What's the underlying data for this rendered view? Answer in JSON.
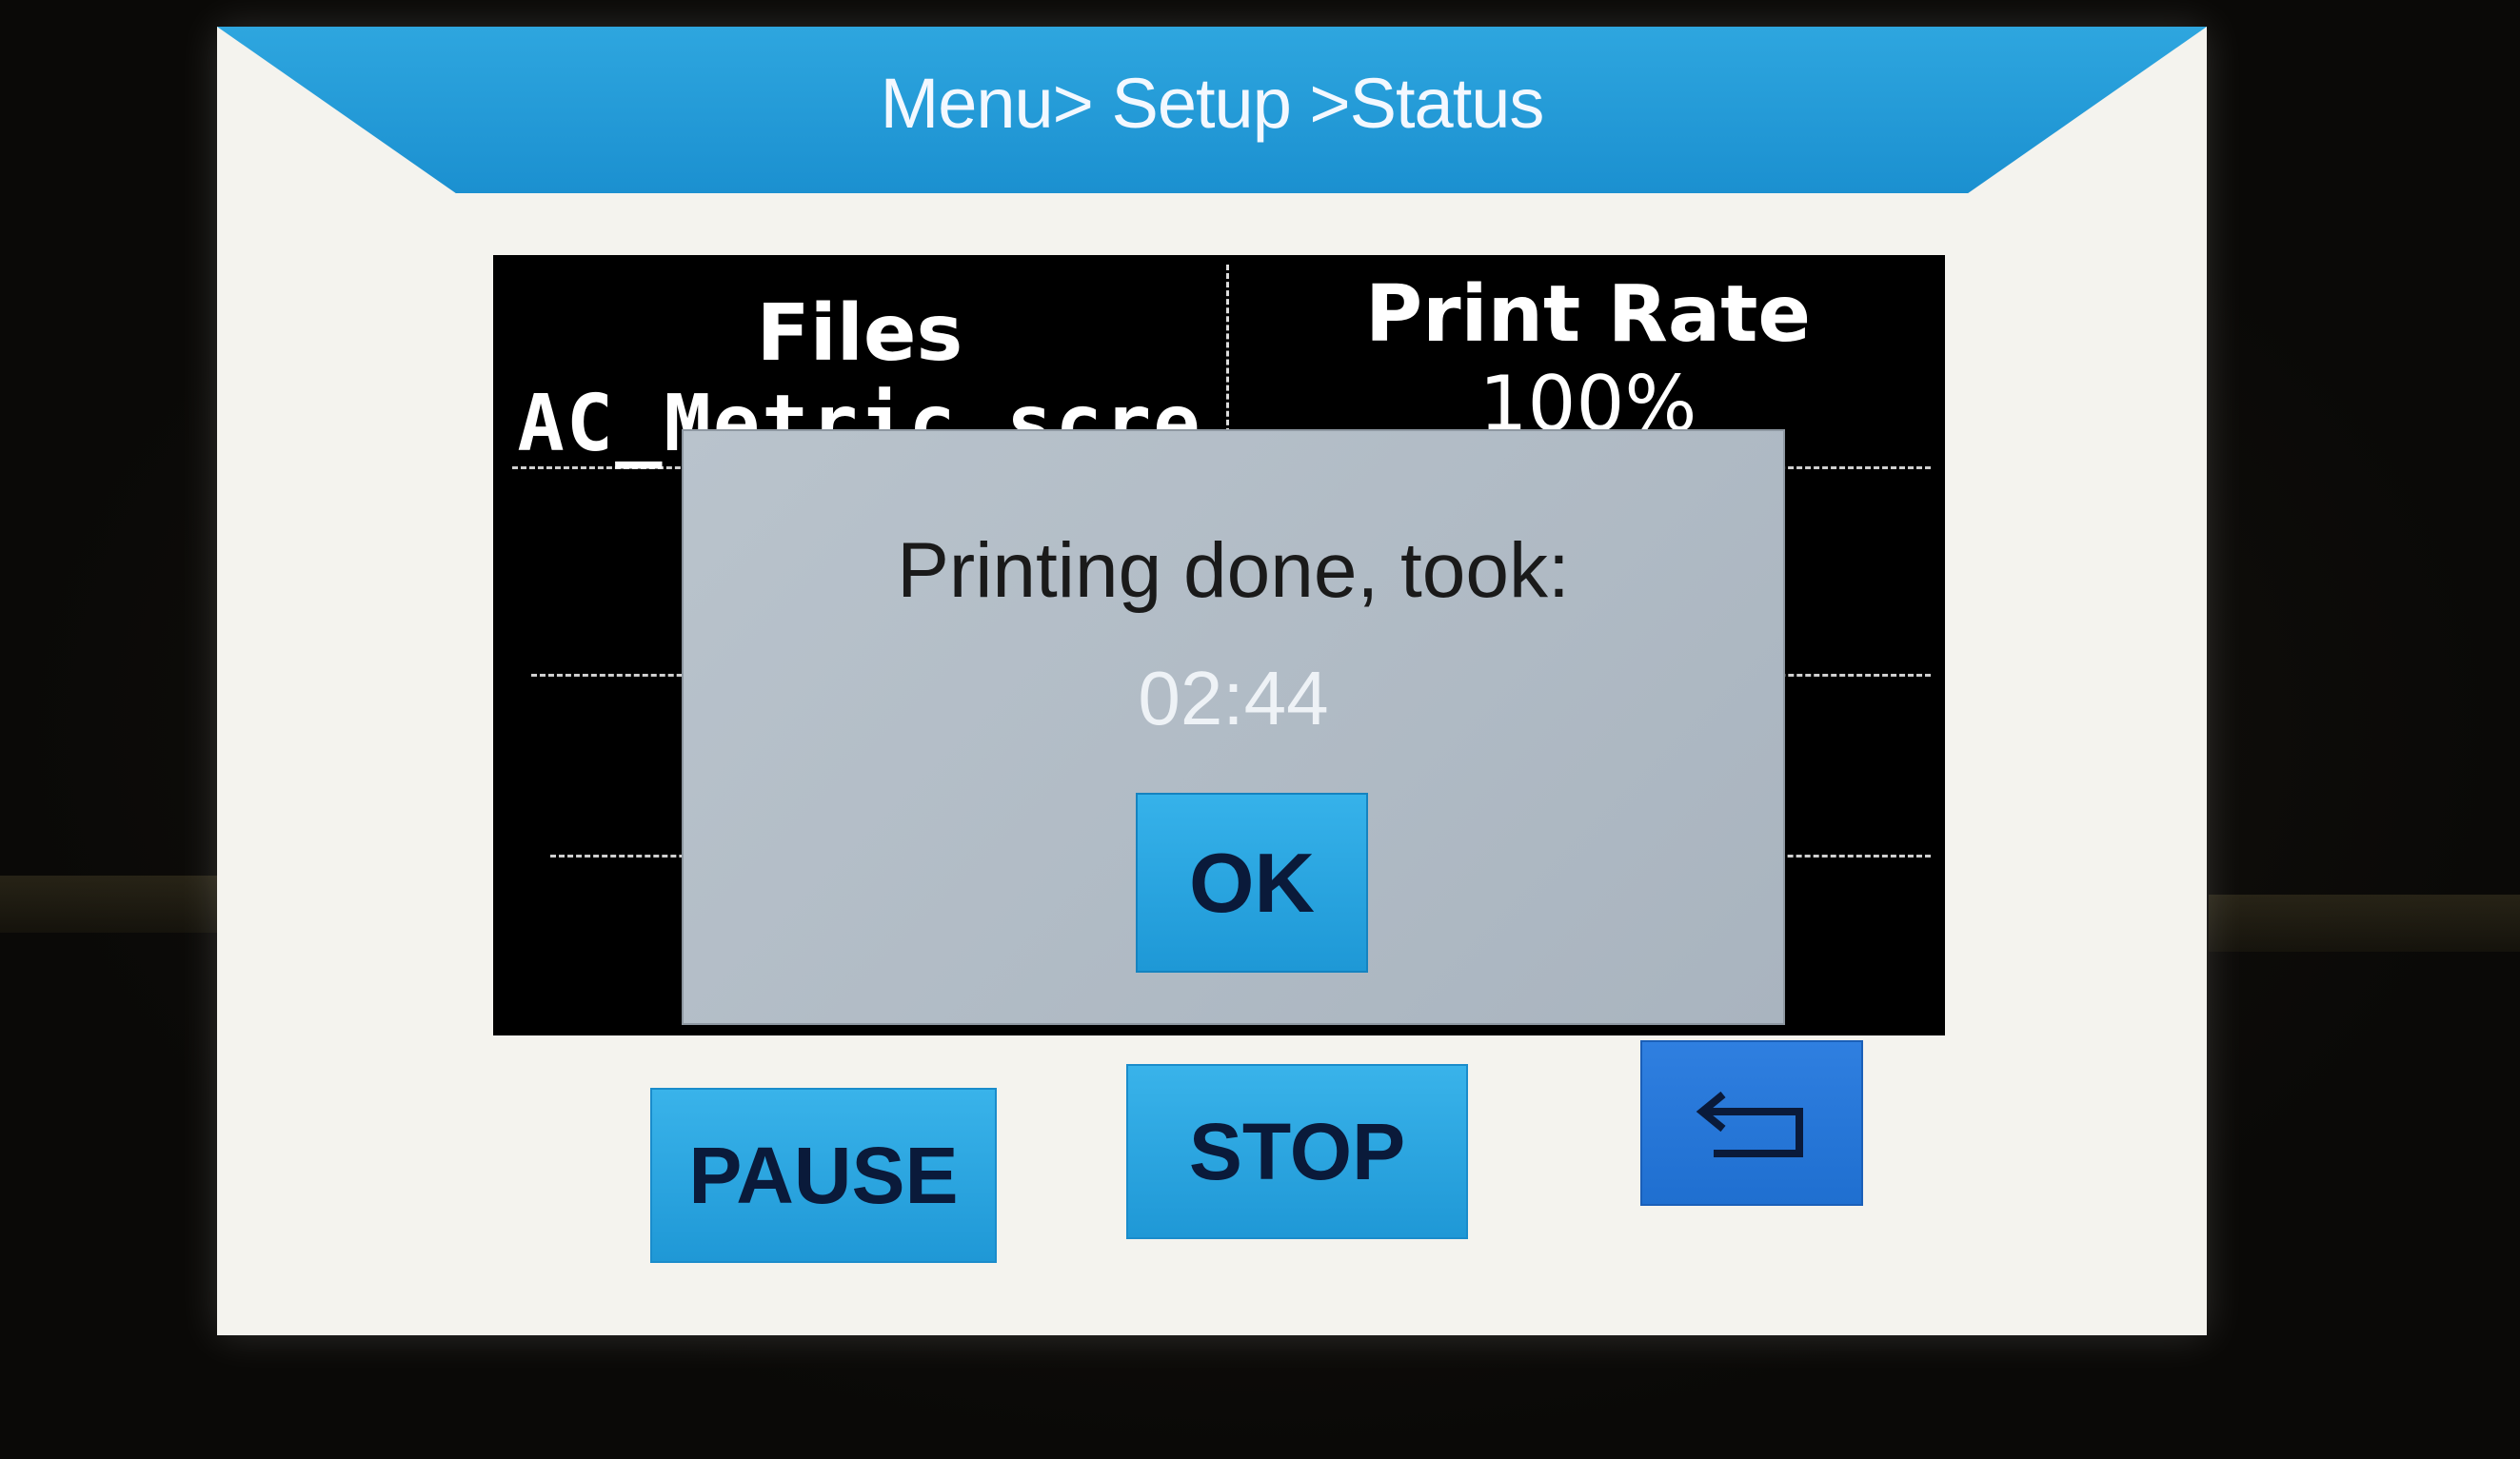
{
  "title_bar": {
    "breadcrumb": "Menu> Setup >Status"
  },
  "status_table": {
    "files_header": "Files",
    "files_value": "AC_Metric_scre",
    "print_rate_header": "Print Rate",
    "print_rate_value": "100%"
  },
  "dialog": {
    "message": "Printing done, took:",
    "elapsed": "02:44",
    "ok_label": "OK"
  },
  "controls": {
    "pause_label": "PAUSE",
    "stop_label": "STOP",
    "back_icon": "return-arrow-icon"
  },
  "colors": {
    "accent_blue": "#2ea6df",
    "back_button_blue": "#2f7fe0",
    "table_bg": "#000000",
    "dialog_bg": "#b9c3cc"
  }
}
